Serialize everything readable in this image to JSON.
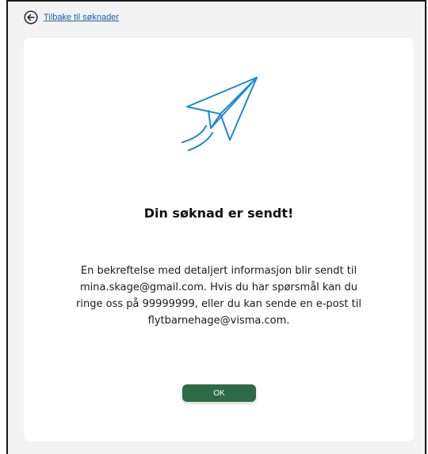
{
  "nav": {
    "back_label": "Tilbake til søknader",
    "back_icon": "arrow-left-circle-icon"
  },
  "confirmation": {
    "illustration": "paper-plane-icon",
    "title": "Din søknad er sendt!",
    "lines": [
      "En bekreftelse med detaljert informasjon blir sendt til",
      "mina.skage@gmail.com. Hvis du har spørsmål kan du",
      "ringe oss på 99999999, eller du kan sende en e-post til",
      "flytbarnehage@visma.com."
    ],
    "ok_label": "OK"
  },
  "colors": {
    "link": "#1b5fa8",
    "plane": "#1a8ad4",
    "button": "#2d6a45",
    "background": "#f3f3f3",
    "card": "#ffffff"
  }
}
